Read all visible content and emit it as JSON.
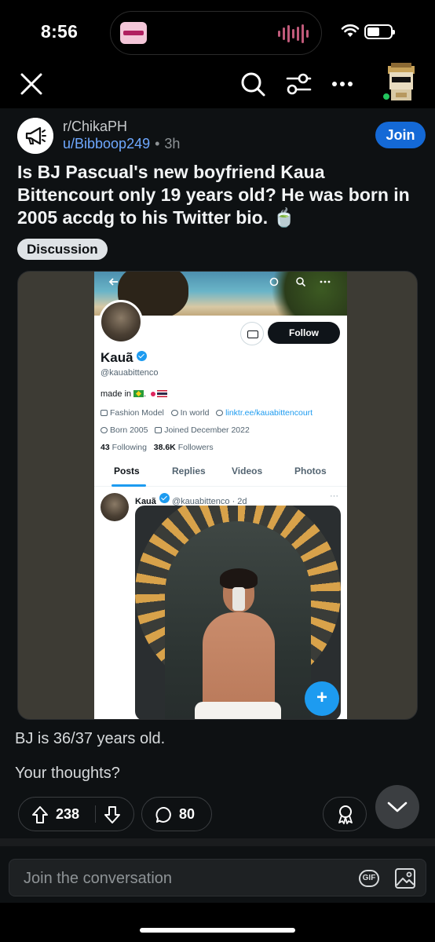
{
  "status_bar": {
    "time": "8:56"
  },
  "nav": {
    "close_icon": "close-icon",
    "search_icon": "search-icon",
    "filter_icon": "filter-icon",
    "more_icon": "more-icon"
  },
  "post": {
    "subreddit": "r/ChikaPH",
    "author": "u/Bibboop249",
    "separator": "•",
    "age": "3h",
    "join_label": "Join",
    "title": "Is BJ Pascual's new boyfriend Kaua Bittencourt only 19 years old? He was born in 2005 accdg to his Twitter bio. 🍵",
    "flair": "Discussion",
    "body_lines": [
      "BJ is 36/37 years old.",
      "Your thoughts?"
    ],
    "upvotes": "238",
    "comments": "80"
  },
  "screenshot": {
    "follow_label": "Follow",
    "display_name": "Kauã",
    "handle": "@kauabittenco",
    "bio_text": "made in",
    "category": "Fashion Model",
    "location": "In world",
    "link": "linktr.ee/kauabittencourt",
    "born": "Born 2005",
    "joined": "Joined December 2022",
    "following_count": "43",
    "following_label": "Following",
    "followers_count": "38.6K",
    "followers_label": "Followers",
    "tabs": [
      "Posts",
      "Replies",
      "Videos",
      "Photos"
    ],
    "tweet_name": "Kauã",
    "tweet_handle_time": "@kauabittenco · 2d",
    "tweet_more": "···",
    "fab_label": "+"
  },
  "composer": {
    "placeholder": "Join the conversation",
    "gif_label": "GIF"
  },
  "colors": {
    "accent": "#1469d6",
    "username": "#6ea8ff",
    "background": "#0e1113",
    "twitter_blue": "#1d9bf0"
  }
}
